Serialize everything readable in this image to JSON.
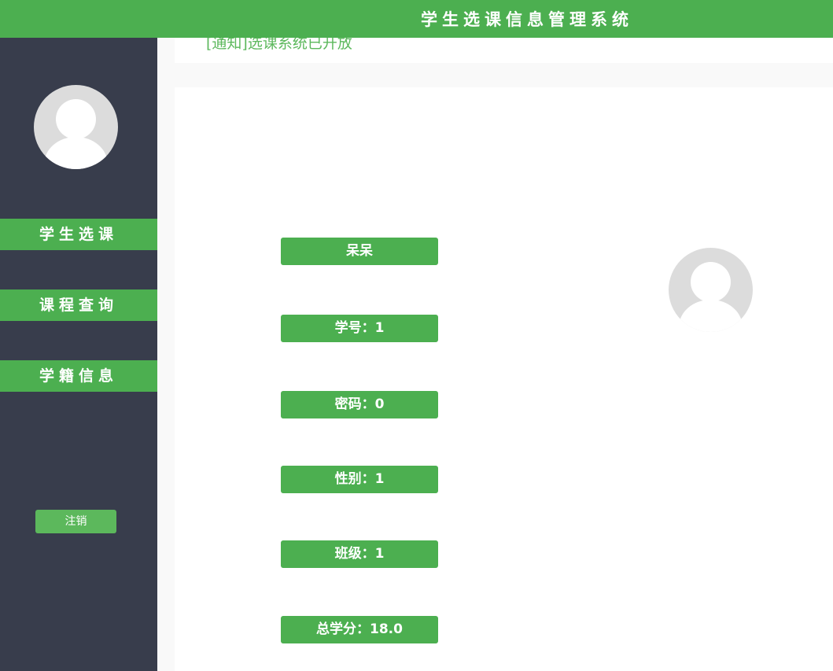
{
  "header": {
    "title": "学生选课信息管理系统"
  },
  "sidebar": {
    "items": [
      {
        "label": "学生选课"
      },
      {
        "label": "课程查询"
      },
      {
        "label": "学籍信息"
      }
    ],
    "logout_label": "注销"
  },
  "notice": {
    "text": "[通知]选课系统已开放"
  },
  "profile": {
    "name": "呆呆",
    "student_id": "学号：1",
    "password": "密码：0",
    "gender": "性别：1",
    "class": "班级：1",
    "total_credits": "总学分：18.0"
  },
  "colors": {
    "accent": "#4caf50",
    "sidebar_bg": "#383d4c",
    "avatar_placeholder": "#dcdcdc"
  },
  "icons": {
    "sidebar_avatar": "user-avatar-icon",
    "profile_avatar": "user-avatar-icon"
  }
}
